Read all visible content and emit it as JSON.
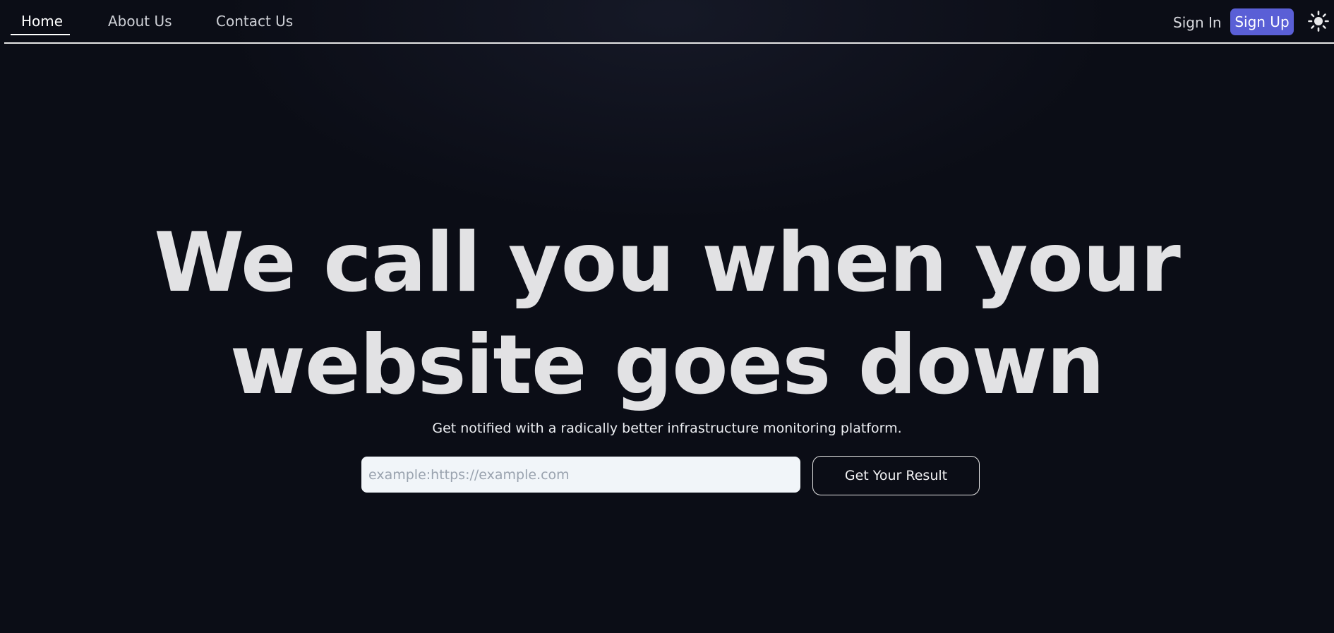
{
  "nav": {
    "links": [
      {
        "label": "Home",
        "active": true
      },
      {
        "label": "About Us",
        "active": false
      },
      {
        "label": "Contact Us",
        "active": false
      }
    ],
    "sign_in": "Sign In",
    "sign_up": "Sign Up",
    "theme_icon": "sun-icon"
  },
  "hero": {
    "title_line1": "We call you when your",
    "title_line2": "website goes down",
    "subtitle": "Get notified with a radically better infrastructure monitoring platform.",
    "input_placeholder": "example:https://example.com",
    "input_value": "",
    "button_label": "Get Your Result"
  },
  "colors": {
    "background": "#0b0d16",
    "accent": "#5a5fd6",
    "title": "#e2e2e4"
  }
}
